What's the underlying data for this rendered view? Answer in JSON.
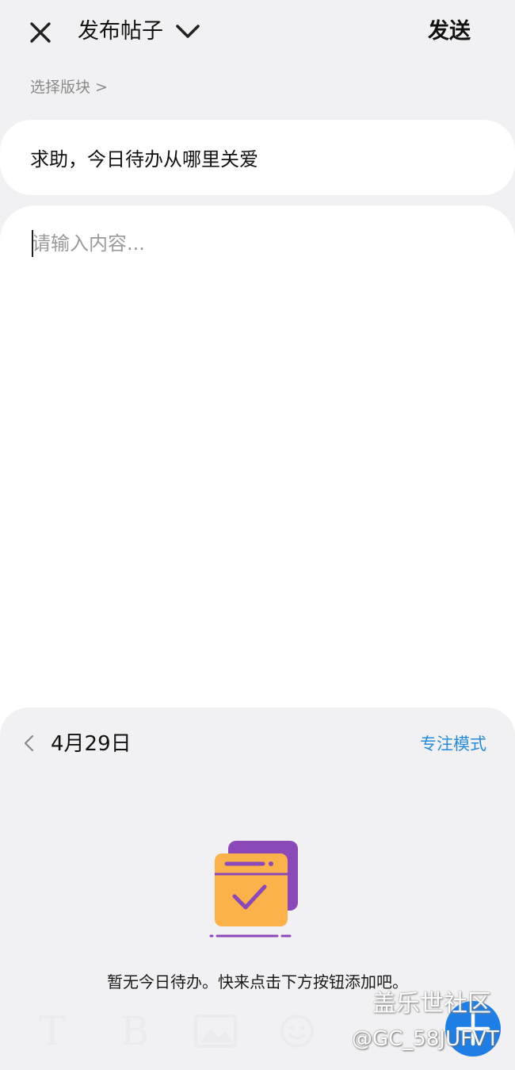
{
  "header": {
    "title": "发布帖子",
    "send_label": "发送",
    "board_link": "选择版块 >"
  },
  "post": {
    "title_value": "求助，今日待办从哪里关爱",
    "content_placeholder": "请输入内容..."
  },
  "todo": {
    "date": "4月29日",
    "focus_mode_label": "专注模式",
    "empty_message": "暂无今日待办。快来点击下方按钮添加吧。"
  },
  "toolbar": {
    "text_tool": "T",
    "bold_tool": "B",
    "image_tool_icon": "image-icon",
    "emoji_tool_icon": "emoji-icon"
  },
  "watermark": {
    "line1": "盖乐世社区",
    "line2": "@GC_58JUFVT"
  },
  "colors": {
    "accent_blue": "#2a8bd8",
    "fab_blue": "#1e7ee6",
    "illus_purple": "#8b48b8",
    "illus_orange": "#fbb24a"
  }
}
